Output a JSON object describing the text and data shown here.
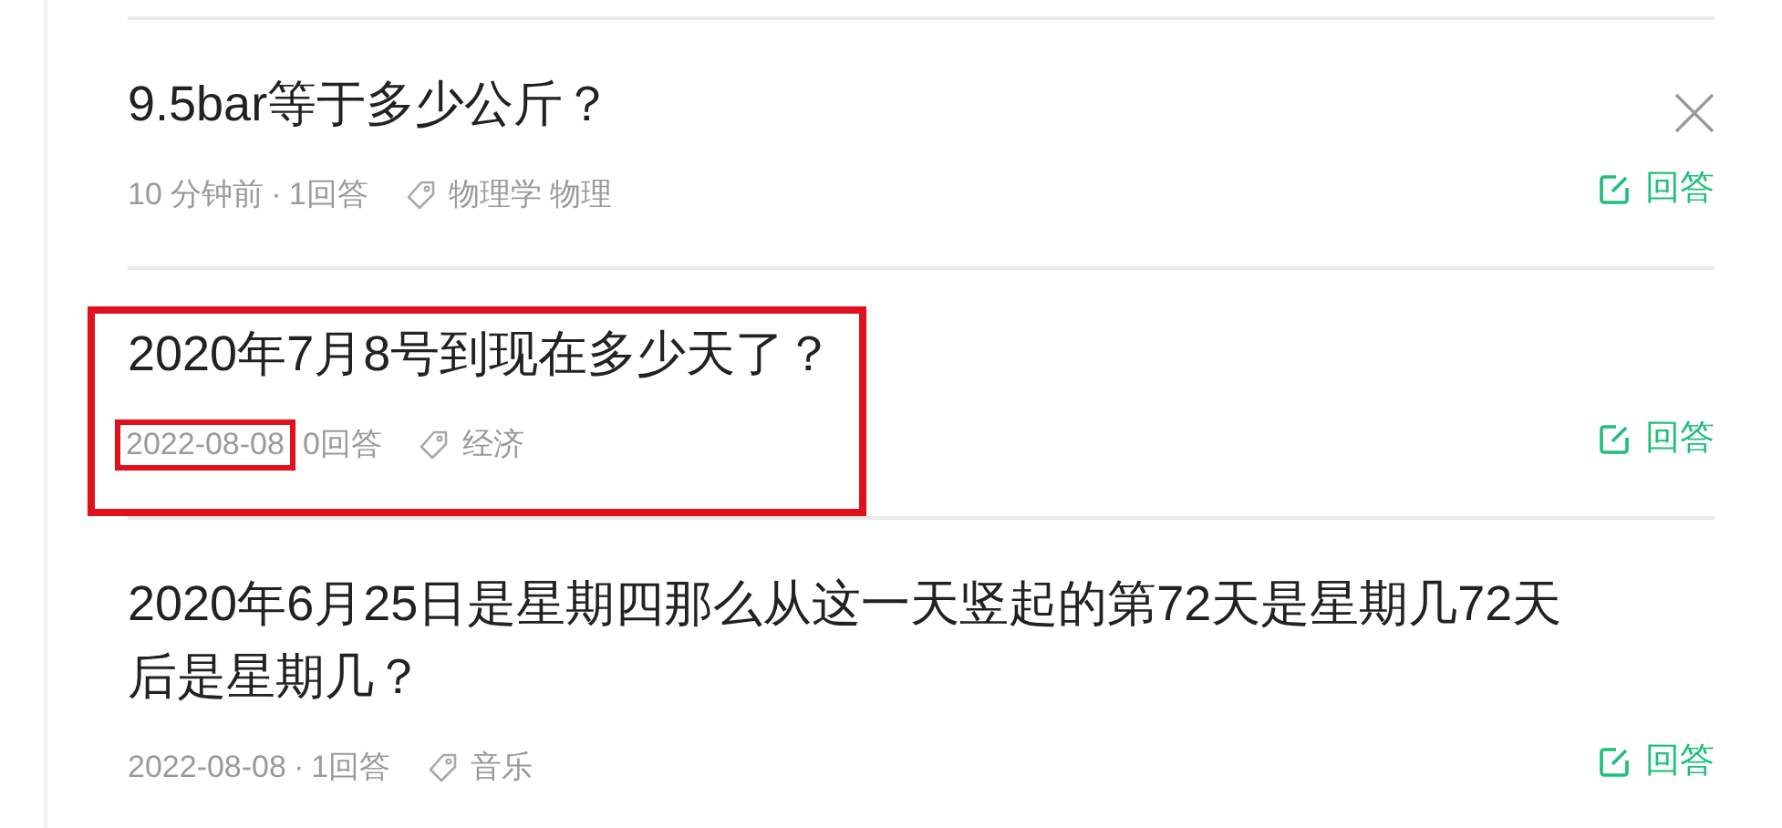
{
  "questions": [
    {
      "title": "9.5bar等于多少公斤？",
      "time": "10 分钟前",
      "separator": "·",
      "answers": "1回答",
      "tags": "物理学 物理",
      "highlighted": false,
      "time_highlighted": false,
      "closable": true,
      "answer_button": "回答"
    },
    {
      "title": "2020年7月8号到现在多少天了？",
      "time": "2022-08-08",
      "answers": "0回答",
      "tags": "经济",
      "highlighted": true,
      "time_highlighted": true,
      "closable": false,
      "answer_button": "回答"
    },
    {
      "title": "2020年6月25日是星期四那么从这一天竖起的第72天是星期几72天后是星期几？",
      "time": "2022-08-08",
      "separator": "·",
      "answers": "1回答",
      "tags": "音乐",
      "highlighted": false,
      "time_highlighted": false,
      "closable": false,
      "answer_button": "回答"
    }
  ]
}
